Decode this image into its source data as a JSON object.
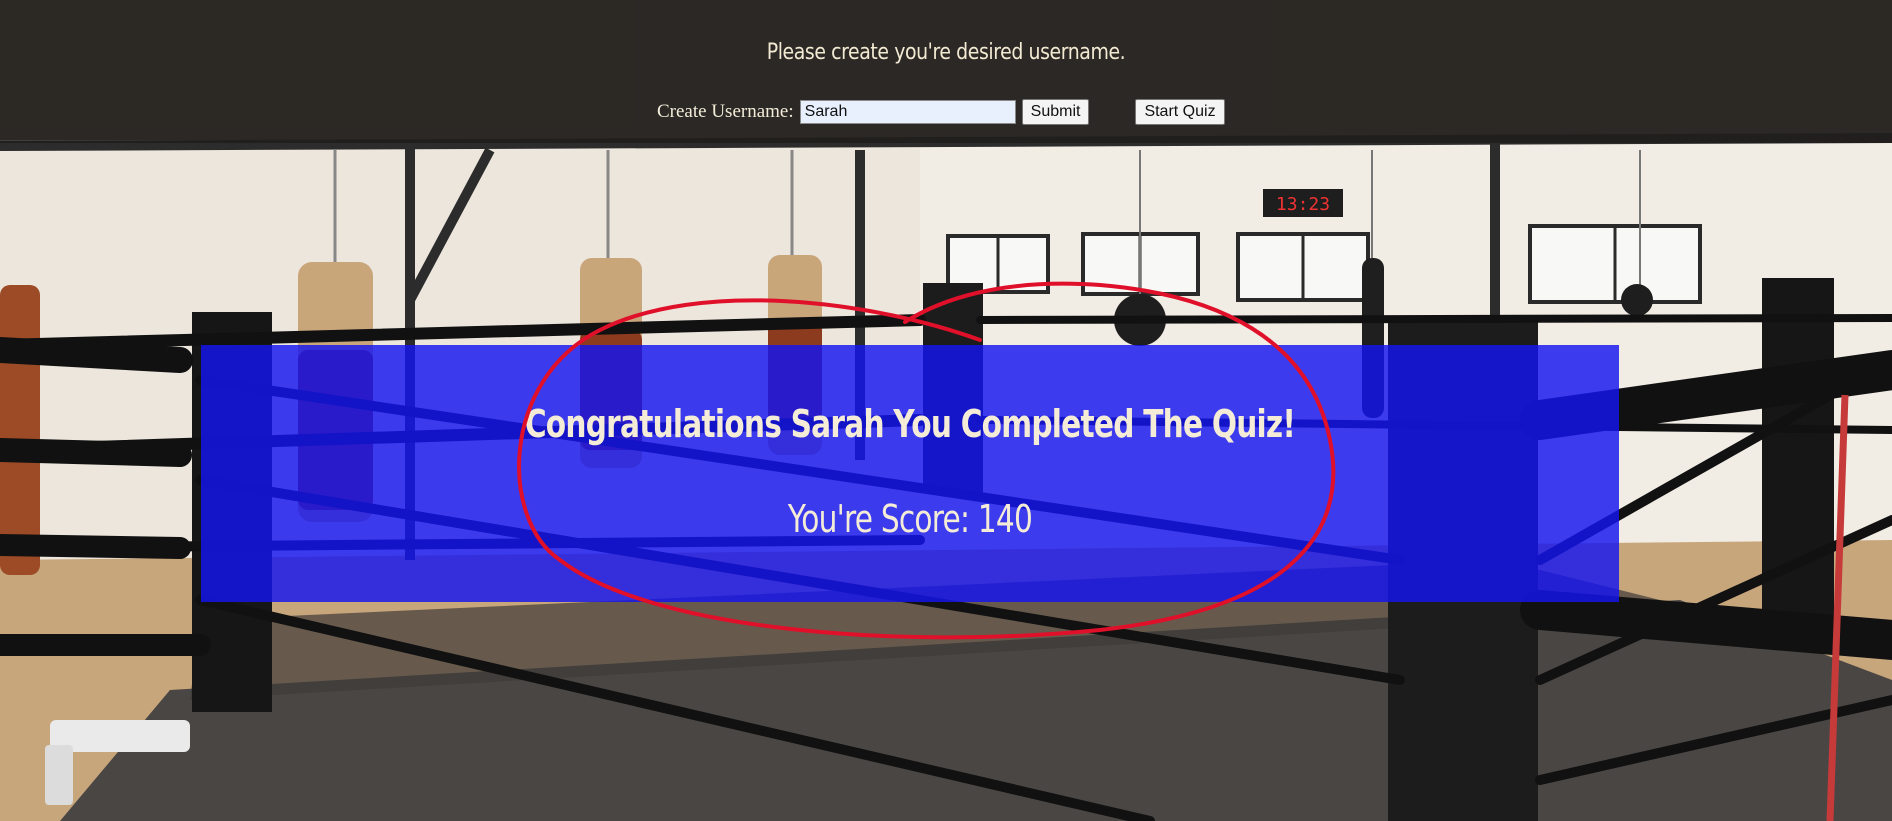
{
  "header": {
    "prompt": "Please create you're desired username."
  },
  "form": {
    "label": "Create Username:",
    "username_value": "Sarah",
    "submit_label": "Submit",
    "start_label": "Start Quiz"
  },
  "result": {
    "message": "Congratulations Sarah You Completed The Quiz!",
    "score_line": "You're Score: 140"
  },
  "scene": {
    "clock_text": "13:23"
  },
  "colors": {
    "panel": "#1414f0",
    "annotation": "#e0102a",
    "text": "#f4ecd6"
  }
}
